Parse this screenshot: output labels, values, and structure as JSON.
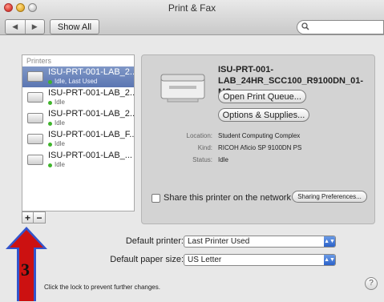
{
  "window": {
    "title": "Print & Fax"
  },
  "toolbar": {
    "back_icon": "◀",
    "forward_icon": "▶",
    "show_all": "Show All",
    "search_icon": "magnifier-icon"
  },
  "printers": {
    "header": "Printers",
    "items": [
      {
        "name": "ISU-PRT-001-LAB_2...",
        "status": "Idle, Last Used",
        "selected": true
      },
      {
        "name": "ISU-PRT-001-LAB_2...",
        "status": "Idle",
        "selected": false
      },
      {
        "name": "ISU-PRT-001-LAB_2...",
        "status": "Idle",
        "selected": false
      },
      {
        "name": "ISU-PRT-001-LAB_F...",
        "status": "Idle",
        "selected": false
      },
      {
        "name": "ISU-PRT-001-LAB_...",
        "status": "Idle",
        "selected": false
      }
    ],
    "add": "+",
    "remove": "−"
  },
  "detail": {
    "name_line1": "ISU-PRT-001-",
    "name_line2": "LAB_24HR_SCC100_R9100DN_01-MS",
    "open_queue": "Open Print Queue...",
    "options_supplies": "Options & Supplies...",
    "location_label": "Location:",
    "location_value": "Student Computing Complex",
    "kind_label": "Kind:",
    "kind_value": "RICOH Aficio SP 9100DN PS",
    "status_label": "Status:",
    "status_value": "Idle",
    "share_label": "Share this printer on the network",
    "share_checked": false,
    "sharing_prefs": "Sharing Preferences..."
  },
  "defaults": {
    "printer_label": "Default printer:",
    "printer_value": "Last Printer Used",
    "paper_label": "Default paper size:",
    "paper_value": "US Letter"
  },
  "footer": {
    "lock_text": "Click the lock to prevent further changes.",
    "help": "?"
  },
  "annotation": {
    "number": "3",
    "arrow_color": "#cc1111",
    "arrow_border": "#3355cc"
  }
}
